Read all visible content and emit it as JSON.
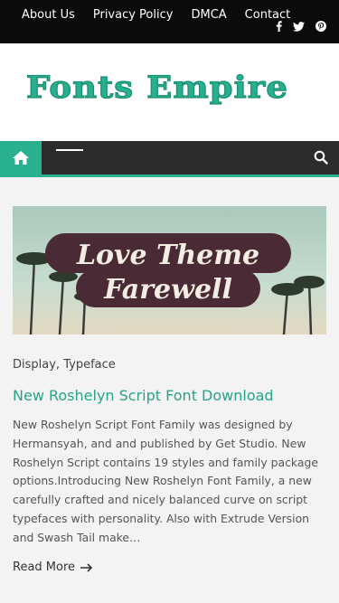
{
  "topnav": {
    "items": [
      "About Us",
      "Privacy Policy",
      "DMCA",
      "Contact"
    ]
  },
  "social": {
    "icons": [
      "facebook-icon",
      "twitter-icon",
      "pinterest-icon"
    ]
  },
  "logo": {
    "text": "Fonts Empire",
    "color": "#27b08f"
  },
  "nav": {
    "accent": "#29b08f"
  },
  "post": {
    "image_text_line1": "Love Theme",
    "image_text_line2": "Farewell",
    "categories": [
      "Display",
      "Typeface"
    ],
    "category_separator": ",",
    "title": "New Roshelyn Script Font Download",
    "excerpt": "New Roshelyn Script Font Family was designed by Hermansyah, and and published by Get Studio. New Roshelyn Script contains 19 styles and family package options.Introducing New Roshelyn Font Family, a new carefully crafted and nicely balanced curve on script typefaces with personality. Also with Extrude Version and Swash Tail make…",
    "read_more": "Read More",
    "title_color": "#29a287"
  }
}
